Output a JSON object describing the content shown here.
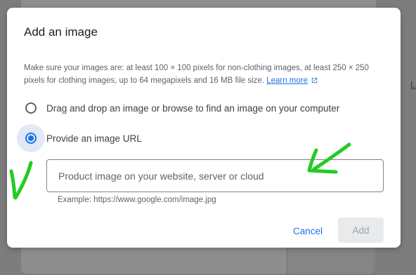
{
  "background": {
    "link_fragment": "Le"
  },
  "dialog": {
    "title": "Add an image",
    "info_text": "Make sure your images are: at least 100 × 100 pixels for non-clothing images, at least 250 × 250 pixels for clothing images, up to 64 megapixels and 16 MB file size.",
    "learn_more": "Learn more",
    "options": [
      {
        "label": "Drag and drop an image or browse to find an image on your computer",
        "selected": false
      },
      {
        "label": "Provide an image URL",
        "selected": true
      }
    ],
    "url_input": {
      "value": "",
      "placeholder": "Product image on your website, server or cloud"
    },
    "hint": "Example: https://www.google.com/image.jpg",
    "cancel_label": "Cancel",
    "add_label": "Add"
  },
  "colors": {
    "accent": "#1a73e8",
    "annotation": "#22cc22",
    "disabled_bg": "#e9eaeb"
  },
  "icons": [
    "external-link-icon",
    "radio-unchecked-icon",
    "radio-checked-icon",
    "arrow-annotation-icon"
  ]
}
